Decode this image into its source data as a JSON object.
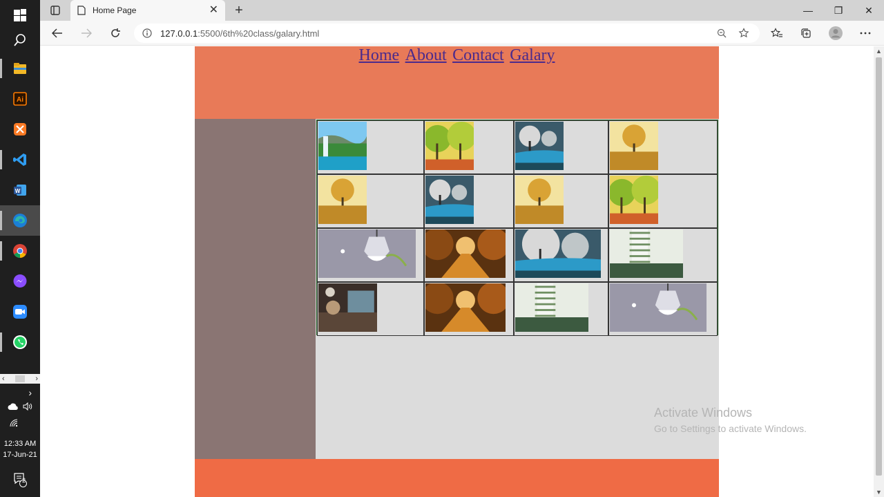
{
  "taskbar": {
    "apps": [
      {
        "name": "start-icon",
        "kind": "windows"
      },
      {
        "name": "search-icon",
        "kind": "search"
      },
      {
        "name": "file-explorer-icon",
        "kind": "explorer",
        "color": "#f2b827"
      },
      {
        "name": "illustrator-icon",
        "kind": "ai",
        "color": "#ff7c00",
        "label": "Ai"
      },
      {
        "name": "xampp-icon",
        "kind": "xampp",
        "color": "#fb7a24"
      },
      {
        "name": "vscode-icon",
        "kind": "vscode",
        "color": "#2f9cf0"
      },
      {
        "name": "word-icon",
        "kind": "word",
        "color": "#2b579a",
        "label": "W"
      },
      {
        "name": "edge-icon",
        "kind": "edge",
        "color": "#2fb6a8"
      },
      {
        "name": "chrome-icon",
        "kind": "chrome"
      },
      {
        "name": "messenger-icon",
        "kind": "messenger",
        "color": "#8a4dff"
      },
      {
        "name": "zoom-icon",
        "kind": "zoom",
        "color": "#2d8cff"
      },
      {
        "name": "whatsapp-icon",
        "kind": "whatsapp",
        "color": "#25d366"
      }
    ],
    "clock_time": "12:33 AM",
    "clock_date": "17-Jun-21",
    "notification_count": "2"
  },
  "browser": {
    "tab_title": "Home Page",
    "url_host": "127.0.0.1",
    "url_rest": ":5500/6th%20class/galary.html"
  },
  "site": {
    "nav": [
      "Home",
      "About",
      "Contact",
      "Galary"
    ],
    "colors": {
      "header": "#e87a58",
      "sidebar": "#8a7573",
      "content": "#dcdcdc",
      "footer": "#ef6b45",
      "link": "#4b2a8c"
    },
    "gallery": [
      [
        {
          "subject": "waterfall-lake",
          "palette": [
            "#7ec8f0",
            "#3a8a3a",
            "#1fa0c8"
          ]
        },
        {
          "subject": "autumn-park-trees",
          "palette": [
            "#e8d35a",
            "#8ab82c",
            "#d0602a"
          ]
        },
        {
          "subject": "blossom-river",
          "palette": [
            "#3a5a6a",
            "#d8d8d8",
            "#2c9ac8"
          ]
        },
        {
          "subject": "golden-field-tree",
          "palette": [
            "#f3e3a0",
            "#c08a28",
            "#d9a335"
          ]
        }
      ],
      [
        {
          "subject": "golden-field-tree",
          "palette": [
            "#f3e3a0",
            "#c08a28",
            "#d9a335"
          ]
        },
        {
          "subject": "blossom-river",
          "palette": [
            "#3a5a6a",
            "#d8d8d8",
            "#2c9ac8"
          ]
        },
        {
          "subject": "golden-field-tree",
          "palette": [
            "#f3e3a0",
            "#c08a28",
            "#d9a335"
          ]
        },
        {
          "subject": "autumn-park-trees",
          "palette": [
            "#e8d35a",
            "#8ab82c",
            "#d0602a"
          ]
        }
      ],
      [
        {
          "subject": "lightbulb-aquarium",
          "palette": [
            "#9a98a8",
            "#e6e6ec",
            "#8ab04a"
          ]
        },
        {
          "subject": "autumn-forest-road",
          "palette": [
            "#5a3210",
            "#d68a2a",
            "#f0c070"
          ]
        },
        {
          "subject": "blossom-river",
          "palette": [
            "#3a5a6a",
            "#d8d8d8",
            "#2c9ac8"
          ]
        },
        {
          "subject": "green-tower",
          "palette": [
            "#e8ede4",
            "#6f8f62",
            "#3c5a40"
          ]
        }
      ],
      [
        {
          "subject": "cafe-interior",
          "palette": [
            "#3a2e28",
            "#b89a78",
            "#6e8e9e"
          ]
        },
        {
          "subject": "autumn-forest-road",
          "palette": [
            "#5a3210",
            "#d68a2a",
            "#f0c070"
          ]
        },
        {
          "subject": "green-tower",
          "palette": [
            "#e8ede4",
            "#6f8f62",
            "#3c5a40"
          ]
        },
        {
          "subject": "lightbulb-aquarium",
          "palette": [
            "#9a98a8",
            "#e6e6ec",
            "#8ab04a"
          ]
        }
      ]
    ]
  },
  "watermark": {
    "line1": "Activate Windows",
    "line2": "Go to Settings to activate Windows."
  }
}
